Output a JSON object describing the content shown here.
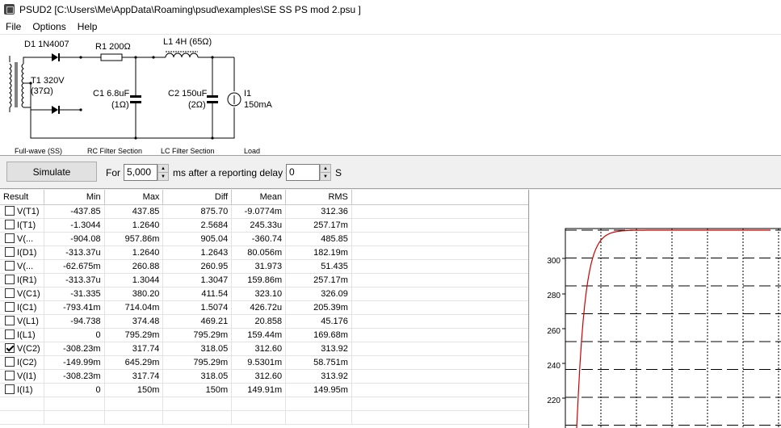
{
  "window": {
    "title": "PSUD2  [C:\\Users\\Me\\AppData\\Roaming\\psud\\examples\\SE SS PS mod 2.psu ]"
  },
  "menu": [
    "File",
    "Options",
    "Help"
  ],
  "schematic": {
    "d1": "D1 1N4007",
    "r1": "R1 200Ω",
    "l1": "L1 4H (65Ω)",
    "t1_a": "T1 320V",
    "t1_b": "(37Ω)",
    "c1_a": "C1 6.8uF",
    "c1_b": "(1Ω)",
    "c2_a": "C2 150uF",
    "c2_b": "(2Ω)",
    "i1_a": "I1",
    "i1_b": "150mA",
    "cap_fullwave": "Full-wave (SS)",
    "cap_rc": "RC Filter Section",
    "cap_lc": "LC Filter Section",
    "cap_load": "Load"
  },
  "toolbar": {
    "simulate": "Simulate",
    "for_label": "For",
    "duration": "5,000",
    "ms_label": "ms  after a reporting delay of",
    "delay": "0",
    "s_label": "S"
  },
  "table": {
    "headers": [
      "Result",
      "Min",
      "Max",
      "Diff",
      "Mean",
      "RMS"
    ],
    "rows": [
      {
        "name": "V(T1)",
        "checked": false,
        "min": "-437.85",
        "max": "437.85",
        "diff": "875.70",
        "mean": "-9.0774m",
        "rms": "312.36"
      },
      {
        "name": "I(T1)",
        "checked": false,
        "min": "-1.3044",
        "max": "1.2640",
        "diff": "2.5684",
        "mean": "245.33u",
        "rms": "257.17m"
      },
      {
        "name": "V(...",
        "checked": false,
        "min": "-904.08",
        "max": "957.86m",
        "diff": "905.04",
        "mean": "-360.74",
        "rms": "485.85"
      },
      {
        "name": "I(D1)",
        "checked": false,
        "min": "-313.37u",
        "max": "1.2640",
        "diff": "1.2643",
        "mean": "80.056m",
        "rms": "182.19m"
      },
      {
        "name": "V(...",
        "checked": false,
        "min": "-62.675m",
        "max": "260.88",
        "diff": "260.95",
        "mean": "31.973",
        "rms": "51.435"
      },
      {
        "name": "I(R1)",
        "checked": false,
        "min": "-313.37u",
        "max": "1.3044",
        "diff": "1.3047",
        "mean": "159.86m",
        "rms": "257.17m"
      },
      {
        "name": "V(C1)",
        "checked": false,
        "min": "-31.335",
        "max": "380.20",
        "diff": "411.54",
        "mean": "323.10",
        "rms": "326.09"
      },
      {
        "name": "I(C1)",
        "checked": false,
        "min": "-793.41m",
        "max": "714.04m",
        "diff": "1.5074",
        "mean": "426.72u",
        "rms": "205.39m"
      },
      {
        "name": "V(L1)",
        "checked": false,
        "min": "-94.738",
        "max": "374.48",
        "diff": "469.21",
        "mean": "20.858",
        "rms": "45.176"
      },
      {
        "name": "I(L1)",
        "checked": false,
        "min": "0",
        "max": "795.29m",
        "diff": "795.29m",
        "mean": "159.44m",
        "rms": "169.68m"
      },
      {
        "name": "V(C2)",
        "checked": true,
        "min": "-308.23m",
        "max": "317.74",
        "diff": "318.05",
        "mean": "312.60",
        "rms": "313.92"
      },
      {
        "name": "I(C2)",
        "checked": false,
        "min": "-149.99m",
        "max": "645.29m",
        "diff": "795.29m",
        "mean": "9.5301m",
        "rms": "58.751m"
      },
      {
        "name": "V(I1)",
        "checked": false,
        "min": "-308.23m",
        "max": "317.74",
        "diff": "318.05",
        "mean": "312.60",
        "rms": "313.92"
      },
      {
        "name": "I(I1)",
        "checked": false,
        "min": "0",
        "max": "150m",
        "diff": "150m",
        "mean": "149.91m",
        "rms": "149.95m"
      }
    ]
  },
  "graph": {
    "yticks": [
      "300",
      "280",
      "260",
      "240",
      "220"
    ],
    "trace_color": "#cc0000"
  }
}
